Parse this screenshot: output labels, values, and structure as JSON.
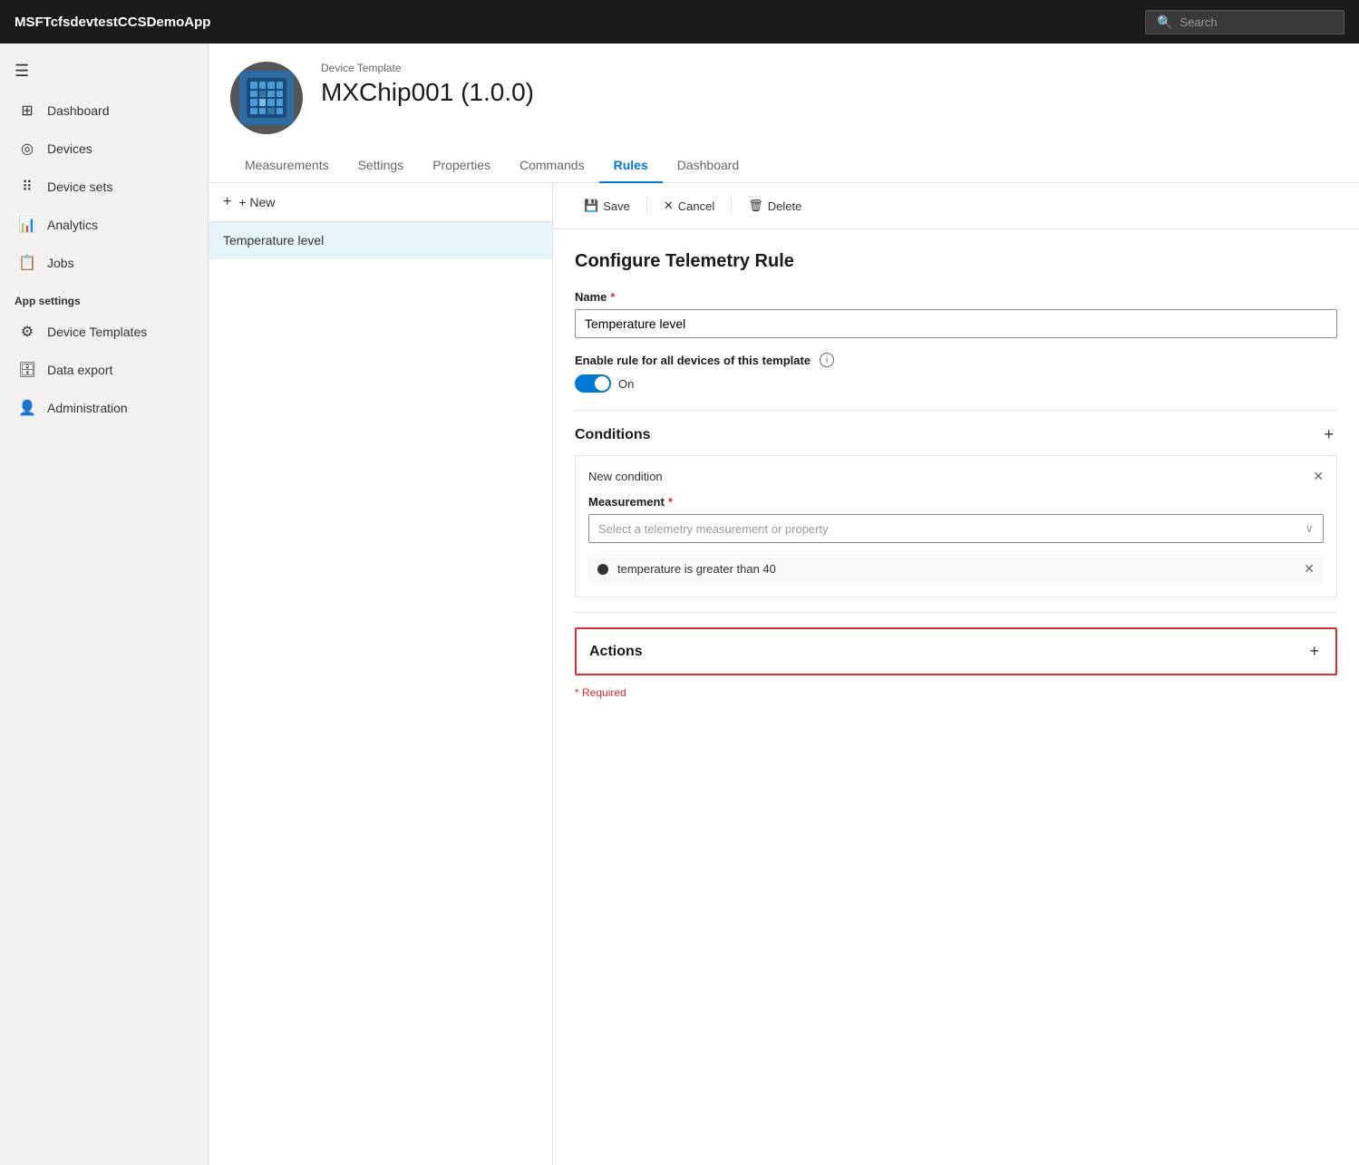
{
  "topbar": {
    "title": "MSFTcfsdevtestCCSDemoApp",
    "search_placeholder": "Search"
  },
  "sidebar": {
    "hamburger": "☰",
    "items": [
      {
        "id": "dashboard",
        "label": "Dashboard",
        "icon": "⊞"
      },
      {
        "id": "devices",
        "label": "Devices",
        "icon": "◎"
      },
      {
        "id": "device-sets",
        "label": "Device sets",
        "icon": "⠿"
      },
      {
        "id": "analytics",
        "label": "Analytics",
        "icon": "📊"
      },
      {
        "id": "jobs",
        "label": "Jobs",
        "icon": "📋"
      }
    ],
    "app_settings_label": "App settings",
    "app_settings_items": [
      {
        "id": "device-templates",
        "label": "Device Templates",
        "icon": "⚙"
      },
      {
        "id": "data-export",
        "label": "Data export",
        "icon": "🗄"
      },
      {
        "id": "administration",
        "label": "Administration",
        "icon": "👤"
      }
    ]
  },
  "device": {
    "template_label": "Device Template",
    "name": "MXChip001  (1.0.0)"
  },
  "tabs": [
    {
      "id": "measurements",
      "label": "Measurements"
    },
    {
      "id": "settings",
      "label": "Settings"
    },
    {
      "id": "properties",
      "label": "Properties"
    },
    {
      "id": "commands",
      "label": "Commands"
    },
    {
      "id": "rules",
      "label": "Rules",
      "active": true
    },
    {
      "id": "dashboard",
      "label": "Dashboard"
    }
  ],
  "left_panel": {
    "new_button": "+ New",
    "rules": [
      {
        "id": "temperature-level",
        "label": "Temperature level"
      }
    ]
  },
  "right_panel": {
    "toolbar": {
      "save_label": "Save",
      "cancel_label": "Cancel",
      "delete_label": "Delete"
    },
    "form": {
      "title": "Configure Telemetry Rule",
      "name_label": "Name",
      "name_required": true,
      "name_value": "Temperature level",
      "toggle_label": "Enable rule for all devices of this template",
      "toggle_state": "On",
      "conditions_label": "Conditions",
      "condition_title": "New condition",
      "measurement_label": "Measurement",
      "measurement_required": true,
      "measurement_placeholder": "Select a telemetry measurement or property",
      "condition_tag": "temperature is greater than 40",
      "actions_label": "Actions",
      "required_note": "* Required"
    }
  }
}
